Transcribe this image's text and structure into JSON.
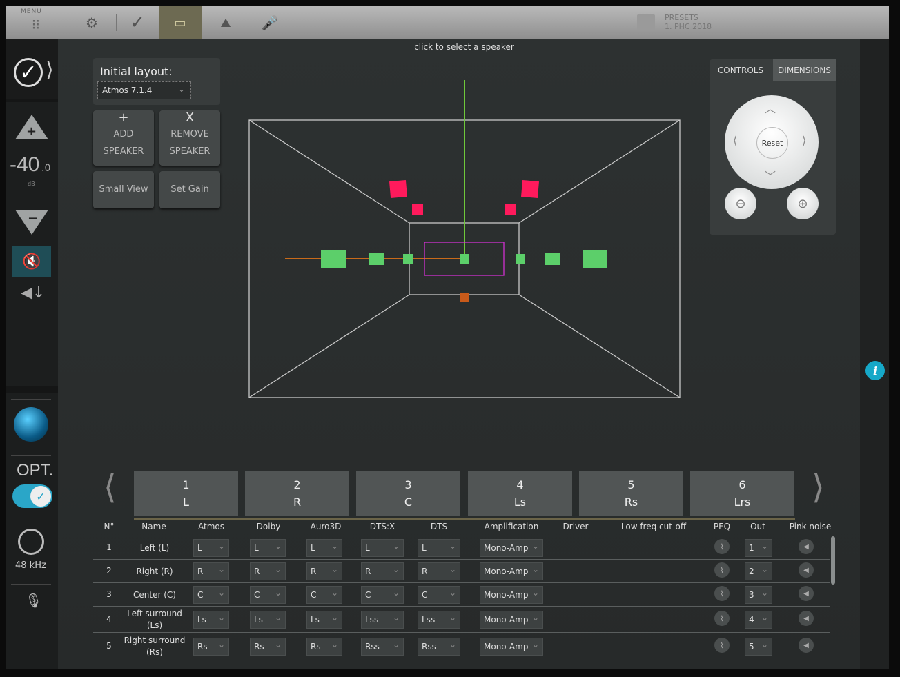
{
  "topbar": {
    "menu_label": "MENU",
    "presets_label": "PRESETS",
    "preset_name": "1. PHC 2018"
  },
  "sidebar": {
    "volume_value": "-40",
    "volume_fraction": ".0",
    "volume_unit": "dB",
    "opt_label": "OPT.",
    "sample_rate": "48 kHz"
  },
  "layout": {
    "title": "Initial layout:",
    "selected": "Atmos 7.1.4",
    "add_icon": "+",
    "add_line1": "ADD",
    "add_line2": "SPEAKER",
    "remove_icon": "X",
    "remove_line1": "REMOVE",
    "remove_line2": "SPEAKER",
    "small_view": "Small View",
    "set_gain": "Set Gain"
  },
  "view": {
    "hint": "click to select a speaker"
  },
  "controls": {
    "tab_controls": "CONTROLS",
    "tab_dimensions": "DIMENSIONS",
    "reset": "Reset"
  },
  "speaker_tabs": [
    {
      "num": "1",
      "code": "L"
    },
    {
      "num": "2",
      "code": "R"
    },
    {
      "num": "3",
      "code": "C"
    },
    {
      "num": "4",
      "code": "Ls"
    },
    {
      "num": "5",
      "code": "Rs"
    },
    {
      "num": "6",
      "code": "Lrs"
    }
  ],
  "table": {
    "headers": [
      "N°",
      "Name",
      "Atmos",
      "Dolby",
      "Auro3D",
      "DTS:X",
      "DTS",
      "Amplification",
      "Driver",
      "Low freq cut-off",
      "PEQ",
      "Out",
      "Pink noise"
    ],
    "rows": [
      {
        "n": "1",
        "name": "Left (L)",
        "atmos": "L",
        "dolby": "L",
        "auro": "L",
        "dtsx": "L",
        "dts": "L",
        "amp": "Mono-Amp",
        "out": "1"
      },
      {
        "n": "2",
        "name": "Right (R)",
        "atmos": "R",
        "dolby": "R",
        "auro": "R",
        "dtsx": "R",
        "dts": "R",
        "amp": "Mono-Amp",
        "out": "2"
      },
      {
        "n": "3",
        "name": "Center (C)",
        "atmos": "C",
        "dolby": "C",
        "auro": "C",
        "dtsx": "C",
        "dts": "C",
        "amp": "Mono-Amp",
        "out": "3"
      },
      {
        "n": "4",
        "name": "Left surround (Ls)",
        "atmos": "Ls",
        "dolby": "Ls",
        "auro": "Ls",
        "dtsx": "Lss",
        "dts": "Lss",
        "amp": "Mono-Amp",
        "out": "4"
      },
      {
        "n": "5",
        "name": "Right surround (Rs)",
        "atmos": "Rs",
        "dolby": "Rs",
        "auro": "Rs",
        "dtsx": "Rss",
        "dts": "Rss",
        "amp": "Mono-Amp",
        "out": "5"
      }
    ]
  },
  "colors": {
    "accent": "#2aa6c8",
    "speaker_floor": "#5ccf6a",
    "speaker_height": "#ff1a5c",
    "listening_area": "#d030d0",
    "axis_vertical": "#6fc83a",
    "axis_horizontal": "#c86a1a",
    "subwoofer": "#c85a1a"
  }
}
